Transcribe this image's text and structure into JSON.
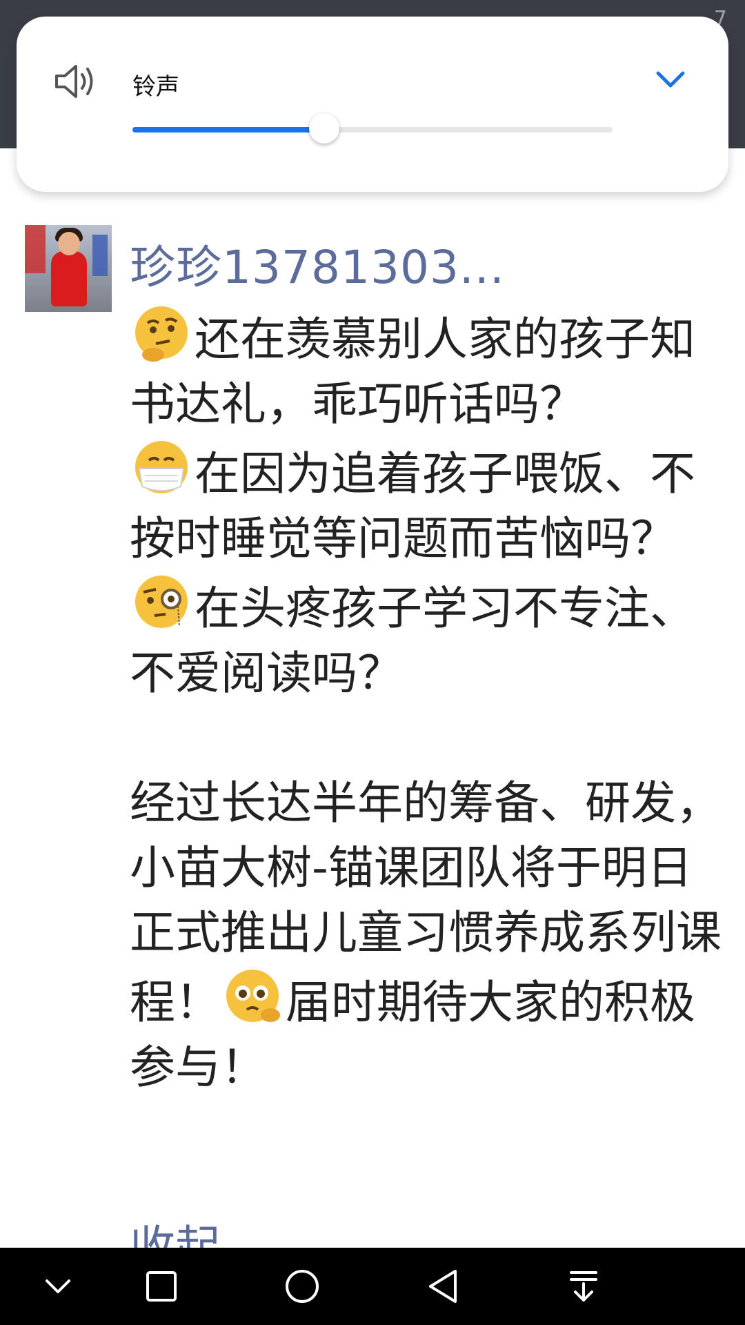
{
  "status_bar": {
    "time_partial": "7"
  },
  "volume_panel": {
    "label": "铃声",
    "level_fraction": 0.4,
    "icons": {
      "speaker": "speaker-icon",
      "expand": "chevron-down-icon"
    },
    "accent_color": "#1a73e8"
  },
  "post": {
    "username": "珍珍13781303...",
    "paragraphs": [
      {
        "emoji": "thinking-face-emoji",
        "text": "还在羡慕别人家的孩子知书达礼，乖巧听话吗？"
      },
      {
        "emoji": "face-with-mask-emoji",
        "text": "在因为追着孩子喂饭、不按时睡觉等问题而苦恼吗？"
      },
      {
        "emoji": "face-with-monocle-emoji",
        "text": "在头疼孩子学习不专注、不爱阅读吗？"
      }
    ],
    "announcement": {
      "before_emoji": "经过长达半年的筹备、研发，小苗大树-锚课团队将于明日正式推出儿童习惯养成系列课程！",
      "emoji": "pleading-face-emoji",
      "after_emoji": "届时期待大家的积极参与！"
    },
    "collapse_label": "收起",
    "link_color": "#5b6b9a"
  },
  "nav_bar": {
    "buttons": [
      {
        "name": "nav-collapse-button",
        "icon": "chevron-down-icon"
      },
      {
        "name": "nav-recents-button",
        "icon": "square-icon"
      },
      {
        "name": "nav-home-button",
        "icon": "circle-icon"
      },
      {
        "name": "nav-back-button",
        "icon": "triangle-back-icon"
      },
      {
        "name": "nav-notification-button",
        "icon": "pull-down-icon"
      }
    ]
  }
}
